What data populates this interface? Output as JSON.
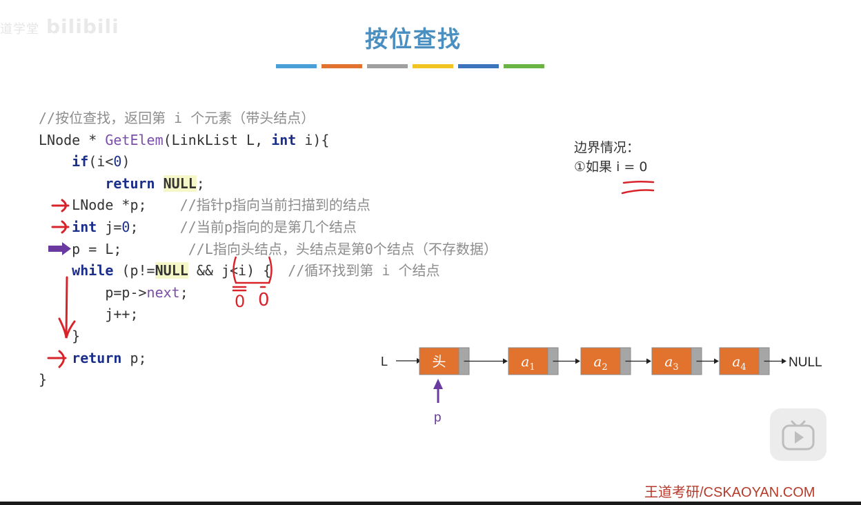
{
  "watermark": {
    "small": "道学堂",
    "brand": "bilibili"
  },
  "title": "按位查找",
  "title_bar_colors": [
    "#4a9fd6",
    "#e2732f",
    "#a0a0a0",
    "#f2c423",
    "#3b73bd",
    "#6ab446"
  ],
  "code": {
    "comment_line": "//按位查找，返回第 i 个元素（带头结点）",
    "sig_ret": "LNode",
    "sig_star": " * ",
    "sig_fn": "GetElem",
    "sig_args_a": "(LinkList L, ",
    "sig_int": "int",
    "sig_args_b": " i){",
    "if_kw": "if",
    "if_cond_a": "(i<",
    "if_zero": "0",
    "if_cond_b": ")",
    "return_kw": "return",
    "null_kw": "NULL",
    "semi": ";",
    "decl_p": "LNode *p;",
    "decl_p_cm": "//指针p指向当前扫描到的结点",
    "int_kw": "int",
    "decl_j": " j=",
    "decl_j_zero": "0",
    "decl_j_end": ";",
    "decl_j_cm": "//当前p指向的是第几个结点",
    "assign_p": "p = L;",
    "assign_p_cm": "//L指向头结点，头结点是第0个结点（不存数据）",
    "while_kw": "while",
    "while_a": " (p!=",
    "while_null": "NULL",
    "while_b": " && ",
    "while_cond": "j<i",
    "while_c": ") {",
    "while_cm": "//循环找到第 i 个结点",
    "next_a": "p=p->",
    "next_fn": "next",
    "next_b": ";",
    "jpp": "j++;",
    "close_brace": "}",
    "ret_kw": "return",
    "ret_val": " p;",
    "fn_close": "}"
  },
  "boundary": {
    "heading": "边界情况：",
    "case1": "①如果 i = 0"
  },
  "annotations": {
    "zero_a": "0",
    "zero_b": "0"
  },
  "list": {
    "start_label": "L",
    "head_label": "头",
    "nodes": [
      "a1",
      "a2",
      "a3",
      "a4"
    ],
    "end_label": "NULL",
    "pointer_label": "p",
    "node_color": "#e2732f",
    "ptr_color": "#a6a6a6"
  },
  "footer": "王道考研/CSKAOYAN.COM"
}
